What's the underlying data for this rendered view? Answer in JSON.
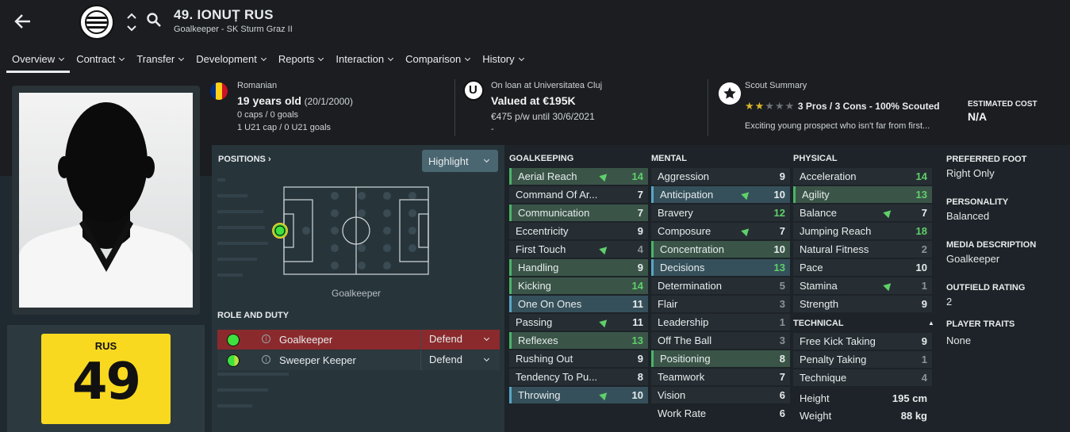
{
  "header": {
    "name": "49. IONUȚ RUS",
    "subtitle": "Goalkeeper - SK Sturm Graz II"
  },
  "tabs": [
    {
      "label": "Overview"
    },
    {
      "label": "Contract"
    },
    {
      "label": "Transfer"
    },
    {
      "label": "Development"
    },
    {
      "label": "Reports"
    },
    {
      "label": "Interaction"
    },
    {
      "label": "Comparison"
    },
    {
      "label": "History"
    }
  ],
  "nationality": {
    "country": "Romanian",
    "age": "19 years old",
    "dob": "(20/1/2000)",
    "caps": "0 caps / 0 goals",
    "u21": "1 U21 cap / 0 U21 goals",
    "flag_colors": [
      "#002b7f",
      "#fcd116",
      "#ce1126"
    ]
  },
  "loan": {
    "status": "On loan at Universitatea Cluj",
    "value": "Valued at €195K",
    "wage": "€475 p/w until 30/6/2021",
    "extra": "-",
    "logo_letter": "U"
  },
  "scout": {
    "title": "Scout Summary",
    "summary": "3 Pros / 3 Cons - 100% Scouted",
    "stars_filled": 2,
    "stars_total": 5,
    "text": "Exciting young prospect who isn't far from first...",
    "cost_label": "ESTIMATED COST",
    "cost_value": "N/A"
  },
  "shirt": {
    "name": "RUS",
    "number": "49",
    "color": "#f8d91f"
  },
  "positions": {
    "title": "POSITIONS ›",
    "highlight": "Highlight",
    "pitch_label": "Goalkeeper"
  },
  "roles": {
    "title": "ROLE AND DUTY",
    "items": [
      {
        "name": "Goalkeeper",
        "duty": "Defend"
      },
      {
        "name": "Sweeper Keeper",
        "duty": "Defend"
      }
    ]
  },
  "goalkeeping": {
    "title": "GOALKEEPING",
    "items": [
      {
        "name": "Aerial Reach",
        "value": "14"
      },
      {
        "name": "Command Of Ar...",
        "value": "7"
      },
      {
        "name": "Communication",
        "value": "7"
      },
      {
        "name": "Eccentricity",
        "value": "9"
      },
      {
        "name": "First Touch",
        "value": "4"
      },
      {
        "name": "Handling",
        "value": "9"
      },
      {
        "name": "Kicking",
        "value": "14"
      },
      {
        "name": "One On Ones",
        "value": "11"
      },
      {
        "name": "Passing",
        "value": "11"
      },
      {
        "name": "Reflexes",
        "value": "13"
      },
      {
        "name": "Rushing Out",
        "value": "9"
      },
      {
        "name": "Tendency To Pu...",
        "value": "8"
      },
      {
        "name": "Throwing",
        "value": "10"
      }
    ]
  },
  "mental": {
    "title": "MENTAL",
    "items": [
      {
        "name": "Aggression",
        "value": "9"
      },
      {
        "name": "Anticipation",
        "value": "10"
      },
      {
        "name": "Bravery",
        "value": "12"
      },
      {
        "name": "Composure",
        "value": "7"
      },
      {
        "name": "Concentration",
        "value": "10"
      },
      {
        "name": "Decisions",
        "value": "13"
      },
      {
        "name": "Determination",
        "value": "5"
      },
      {
        "name": "Flair",
        "value": "3"
      },
      {
        "name": "Leadership",
        "value": "1"
      },
      {
        "name": "Off The Ball",
        "value": "3"
      },
      {
        "name": "Positioning",
        "value": "8"
      },
      {
        "name": "Teamwork",
        "value": "7"
      },
      {
        "name": "Vision",
        "value": "6"
      },
      {
        "name": "Work Rate",
        "value": "6"
      }
    ]
  },
  "physical": {
    "title": "PHYSICAL",
    "items": [
      {
        "name": "Acceleration",
        "value": "14"
      },
      {
        "name": "Agility",
        "value": "13"
      },
      {
        "name": "Balance",
        "value": "7"
      },
      {
        "name": "Jumping Reach",
        "value": "18"
      },
      {
        "name": "Natural Fitness",
        "value": "2"
      },
      {
        "name": "Pace",
        "value": "10"
      },
      {
        "name": "Stamina",
        "value": "1"
      },
      {
        "name": "Strength",
        "value": "9"
      }
    ]
  },
  "technical": {
    "title": "TECHNICAL",
    "items": [
      {
        "name": "Free Kick Taking",
        "value": "9"
      },
      {
        "name": "Penalty Taking",
        "value": "1"
      },
      {
        "name": "Technique",
        "value": "4"
      }
    ]
  },
  "body": {
    "height_label": "Height",
    "height": "195 cm",
    "weight_label": "Weight",
    "weight": "88 kg"
  },
  "details": {
    "foot_label": "PREFERRED FOOT",
    "foot": "Right Only",
    "personality_label": "PERSONALITY",
    "personality": "Balanced",
    "media_label": "MEDIA DESCRIPTION",
    "media": "Goalkeeper",
    "outfield_label": "OUTFIELD RATING",
    "outfield": "2",
    "traits_label": "PLAYER TRAITS",
    "traits": "None"
  }
}
